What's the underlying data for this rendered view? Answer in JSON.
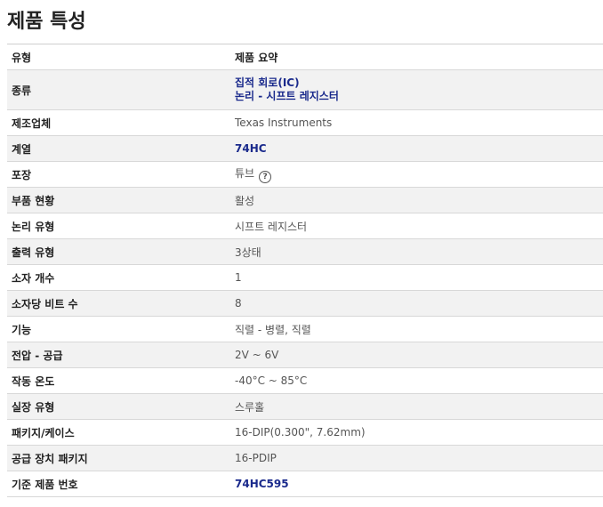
{
  "title": "제품 특성",
  "header": {
    "col1": "유형",
    "col2": "제품 요약"
  },
  "rows": [
    {
      "label": "종류",
      "values": [
        "집적 회로(IC)",
        "논리 - 시프트 레지스터"
      ],
      "link": true
    },
    {
      "label": "제조업체",
      "value": "Texas Instruments"
    },
    {
      "label": "계열",
      "value": "74HC",
      "link": true
    },
    {
      "label": "포장",
      "value": "튜브",
      "help_icon": "question-circle-icon"
    },
    {
      "label": "부품 현황",
      "value": "활성"
    },
    {
      "label": "논리 유형",
      "value": "시프트 레지스터"
    },
    {
      "label": "출력 유형",
      "value": "3상태"
    },
    {
      "label": "소자 개수",
      "value": "1"
    },
    {
      "label": "소자당 비트 수",
      "value": "8"
    },
    {
      "label": "기능",
      "value": "직렬 - 병렬, 직렬"
    },
    {
      "label": "전압 - 공급",
      "value": "2V ~ 6V"
    },
    {
      "label": "작동 온도",
      "value": "-40°C ~ 85°C"
    },
    {
      "label": "실장 유형",
      "value": "스루홀"
    },
    {
      "label": "패키지/케이스",
      "value": "16-DIP(0.300\", 7.62mm)"
    },
    {
      "label": "공급 장치 패키지",
      "value": "16-PDIP"
    },
    {
      "label": "기준 제품 번호",
      "value": "74HC595",
      "link": true
    }
  ],
  "colors": {
    "link": "#1a2a8c",
    "stripe": "#f2f2f2"
  }
}
